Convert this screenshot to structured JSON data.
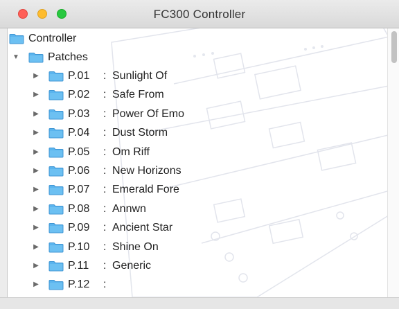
{
  "window": {
    "title": "FC300 Controller"
  },
  "tree": {
    "root": {
      "label": "Controller"
    },
    "patches": {
      "label": "Patches",
      "expanded": true
    },
    "items": [
      {
        "num": "P.01",
        "sep": ":",
        "name": "Sunlight Of"
      },
      {
        "num": "P.02",
        "sep": ":",
        "name": "Safe From"
      },
      {
        "num": "P.03",
        "sep": ":",
        "name": "Power Of Emo"
      },
      {
        "num": "P.04",
        "sep": ":",
        "name": "Dust Storm"
      },
      {
        "num": "P.05",
        "sep": ":",
        "name": "Om Riff"
      },
      {
        "num": "P.06",
        "sep": ":",
        "name": "New Horizons"
      },
      {
        "num": "P.07",
        "sep": ":",
        "name": "Emerald Fore"
      },
      {
        "num": "P.08",
        "sep": ":",
        "name": "Annwn"
      },
      {
        "num": "P.09",
        "sep": ":",
        "name": "Ancient Star"
      },
      {
        "num": "P.10",
        "sep": ":",
        "name": "Shine On"
      },
      {
        "num": "P.11",
        "sep": ":",
        "name": "Generic"
      },
      {
        "num": "P.12",
        "sep": ":",
        "name": ""
      }
    ]
  },
  "colors": {
    "folder": "#5ab4ee",
    "folder_dark": "#3f95d3",
    "close": "#ff5f57",
    "minimize": "#febc2e",
    "zoom": "#28c840"
  },
  "icons": {
    "folder": "folder-icon",
    "collapsed": "disclosure-right-icon",
    "expanded": "disclosure-down-icon"
  }
}
